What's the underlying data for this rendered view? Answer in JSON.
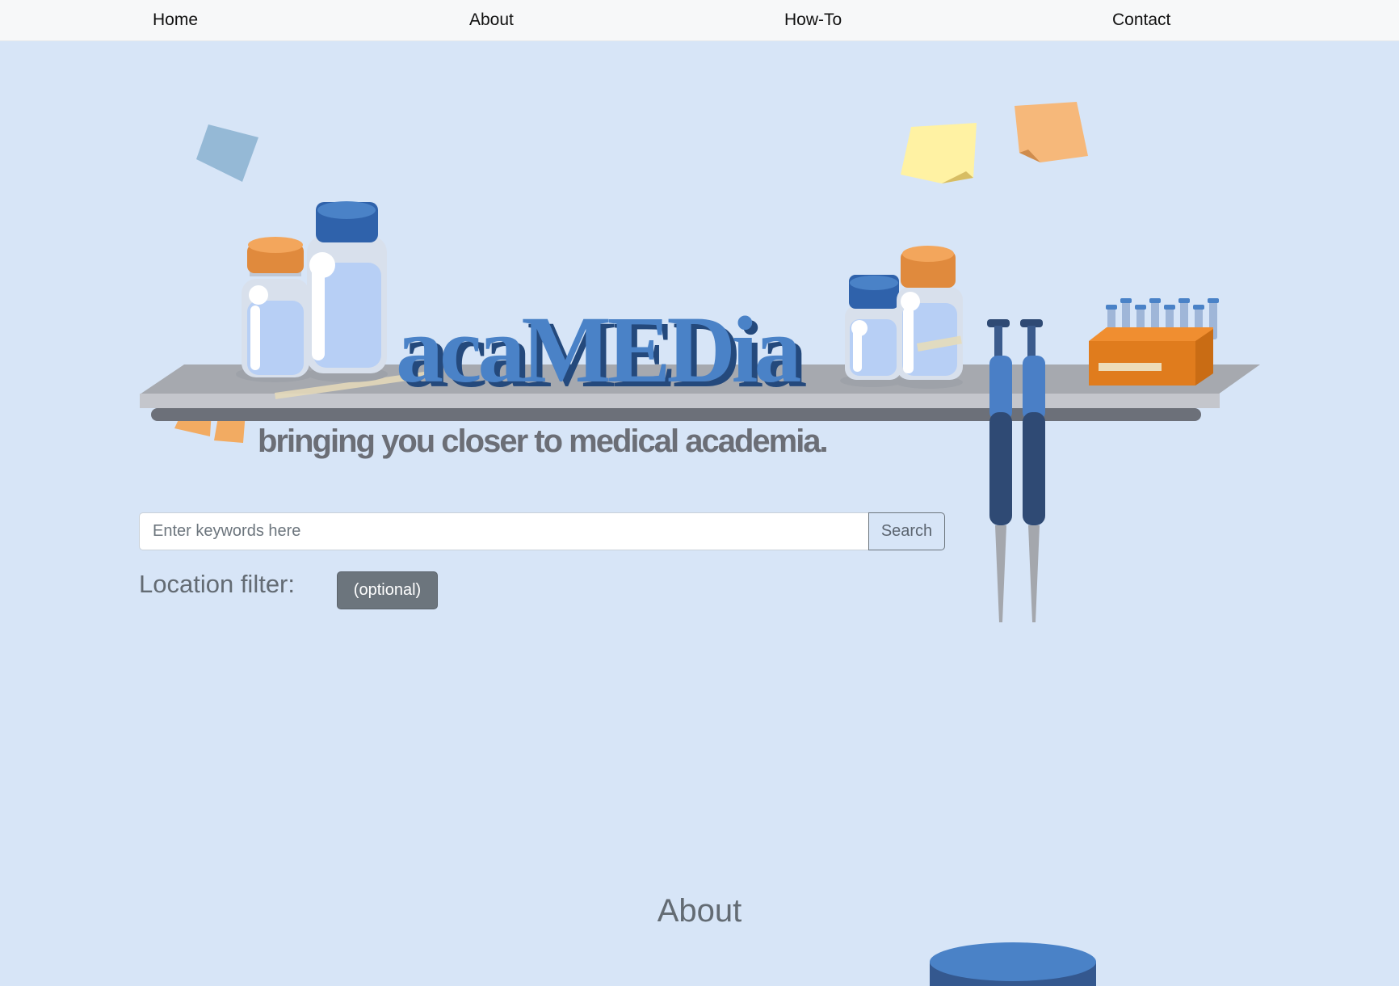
{
  "nav": {
    "items": [
      {
        "label": "Home"
      },
      {
        "label": "About"
      },
      {
        "label": "How-To"
      },
      {
        "label": "Contact"
      }
    ]
  },
  "hero": {
    "logo_text": "acaMEDia",
    "tagline": "bringing you closer to medical academia."
  },
  "search": {
    "placeholder": "Enter keywords here",
    "value": "",
    "button_label": "Search"
  },
  "location_filter": {
    "label": "Location filter:",
    "button_label": "(optional)"
  },
  "about": {
    "heading": "About"
  },
  "colors": {
    "background": "#d7e5f7",
    "navbar": "#f7f8f9",
    "brand_blue": "#4a82c7",
    "button_gray": "#6c757d",
    "text_gray": "#636b73"
  },
  "icons": [
    "lab-bottle-icon",
    "pipette-icon",
    "test-tube-rack-icon",
    "sticky-note-icon"
  ]
}
